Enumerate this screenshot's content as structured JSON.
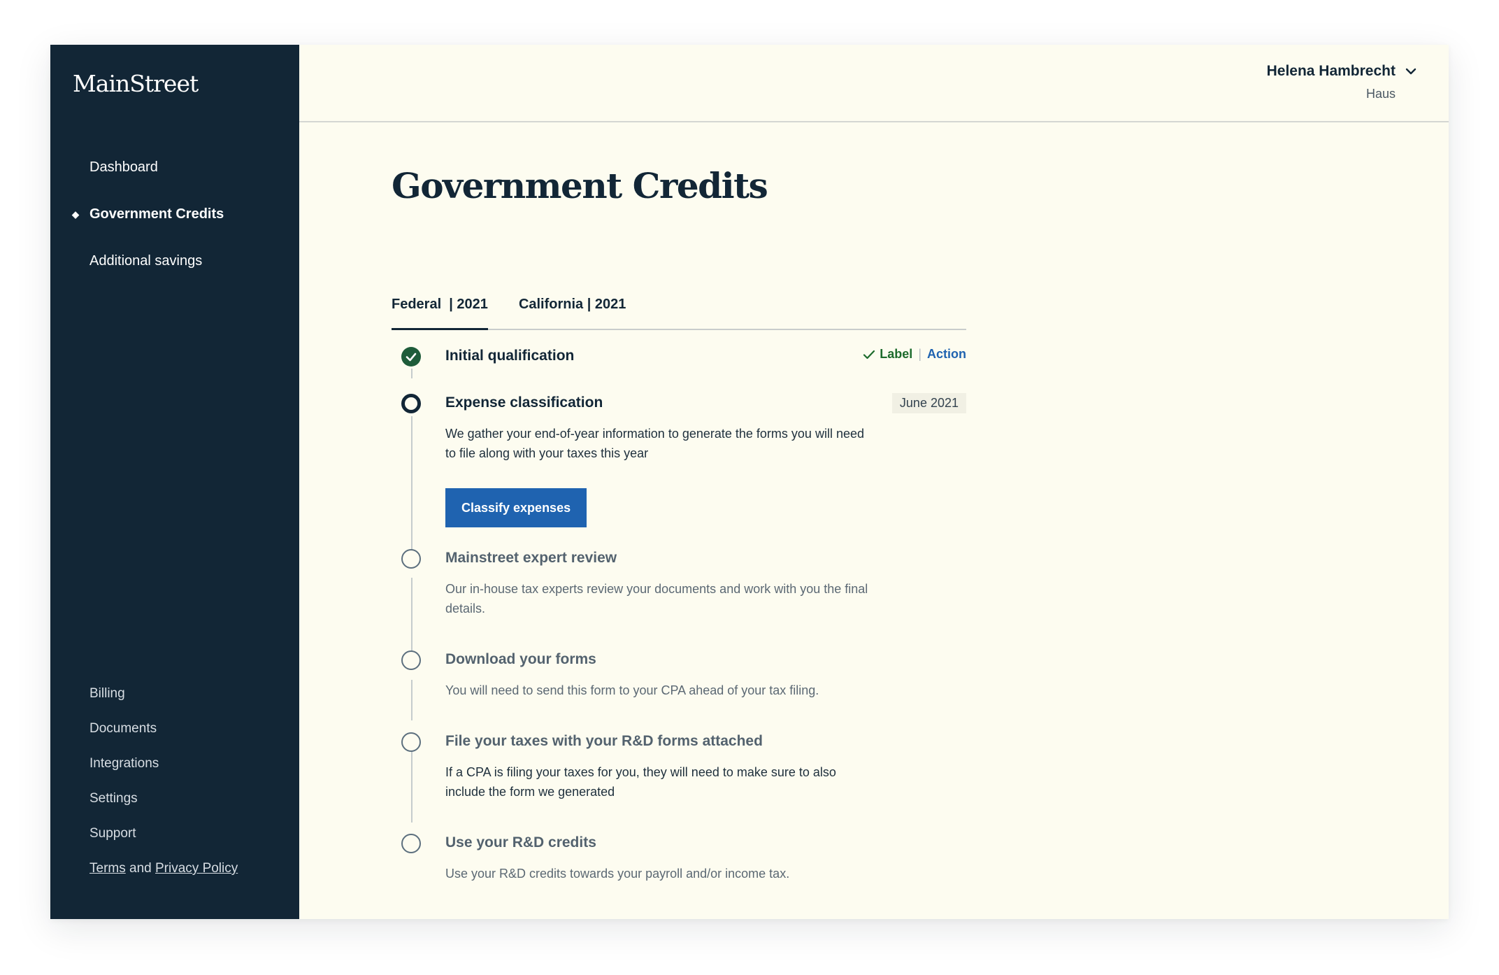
{
  "brand": {
    "name": "MainStreet"
  },
  "sidebar": {
    "nav": [
      {
        "label": "Dashboard"
      },
      {
        "label": "Government Credits",
        "active": true
      },
      {
        "label": "Additional savings"
      }
    ],
    "footer": [
      {
        "label": "Billing"
      },
      {
        "label": "Documents"
      },
      {
        "label": "Integrations"
      },
      {
        "label": "Settings"
      },
      {
        "label": "Support"
      }
    ],
    "legal": {
      "terms": "Terms",
      "and": "and",
      "privacy": "Privacy Policy"
    }
  },
  "header": {
    "user_name": "Helena Hambrecht",
    "org": "Haus"
  },
  "page": {
    "title": "Government Credits",
    "tabs": [
      {
        "label": "Federal",
        "year": "| 2021",
        "active": true
      },
      {
        "label": "California",
        "year": "| 2021",
        "active": false
      }
    ]
  },
  "steps": [
    {
      "title": "Initial qualification",
      "state": "done",
      "status_label": "Label",
      "status_action": "Action"
    },
    {
      "title": "Expense classification",
      "state": "current",
      "date": "June 2021",
      "desc": "We gather your end-of-year information to generate the forms you will need to file along with your taxes this year",
      "button": "Classify expenses"
    },
    {
      "title": "Mainstreet expert review",
      "state": "todo",
      "desc": "Our in-house tax experts review your documents and work with you the final details."
    },
    {
      "title": "Download your forms",
      "state": "todo",
      "desc": "You will need to send this form to your CPA ahead of your tax filing."
    },
    {
      "title": "File your taxes with your R&D forms attached",
      "state": "todo",
      "desc": "If a CPA is filing your taxes for you, they will need to make sure to also include the form we generated"
    },
    {
      "title": "Use your R&D credits",
      "state": "todo",
      "desc": "Use your R&D credits towards your payroll and/or income tax."
    }
  ],
  "colors": {
    "sidebar_bg": "#122636",
    "main_bg": "#fdfcf0",
    "accent_blue": "#1f63b0",
    "success_green": "#1e5c3a"
  },
  "icons": {
    "active_nav": "diamond-icon",
    "user_menu": "chevron-down-icon",
    "step_done": "check-circle-icon",
    "status_check": "check-icon"
  }
}
